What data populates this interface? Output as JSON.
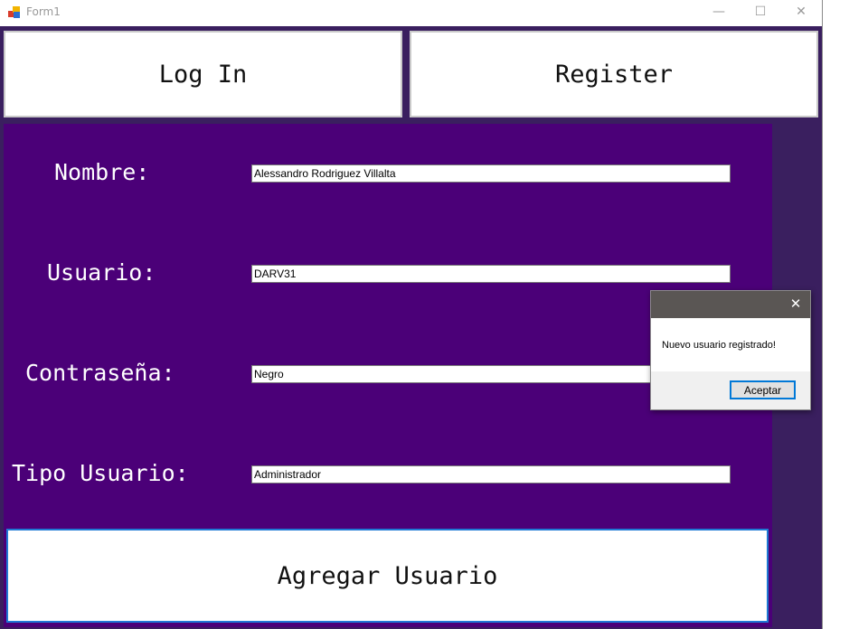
{
  "window": {
    "title": "Form1",
    "icon": "winforms-app-icon",
    "controls": {
      "minimize": "—",
      "maximize": "☐",
      "close": "✕"
    }
  },
  "tabs": {
    "login_label": "Log In",
    "register_label": "Register"
  },
  "form": {
    "fields": [
      {
        "label": "Nombre:",
        "value": "Alessandro Rodriguez Villalta"
      },
      {
        "label": "Usuario:",
        "value": "DARV31"
      },
      {
        "label": "Contraseña:",
        "value": "Negro"
      },
      {
        "label": "Tipo Usuario:",
        "value": "Administrador"
      }
    ],
    "submit_label": "Agregar Usuario"
  },
  "dialog": {
    "close": "✕",
    "message": "Nuevo usuario registrado!",
    "ok_label": "Aceptar"
  },
  "colors": {
    "panel": "#4b0078",
    "window_background": "#3a1f5f",
    "focus_border": "#0078d7"
  }
}
